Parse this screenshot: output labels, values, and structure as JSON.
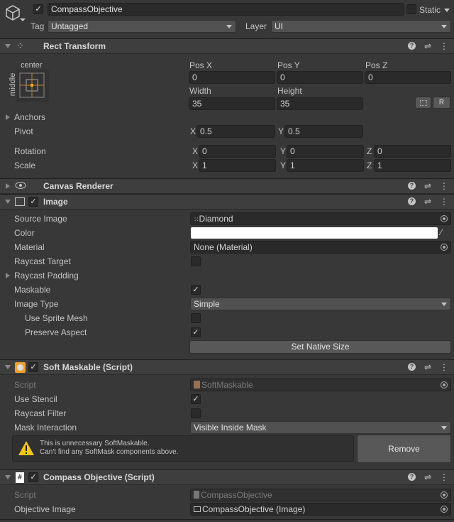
{
  "object": {
    "name": "CompassObjective",
    "active": true,
    "static_label": "Static",
    "static": false,
    "tag_label": "Tag",
    "tag": "Untagged",
    "layer_label": "Layer",
    "layer": "UI"
  },
  "rect_transform": {
    "title": "Rect Transform",
    "anchor_h": "center",
    "anchor_v": "middle",
    "pos_x_label": "Pos X",
    "pos_y_label": "Pos Y",
    "pos_z_label": "Pos Z",
    "pos_x": "0",
    "pos_y": "0",
    "pos_z": "0",
    "width_label": "Width",
    "height_label": "Height",
    "width": "35",
    "height": "35",
    "raw_button": "R",
    "anchors_label": "Anchors",
    "pivot_label": "Pivot",
    "pivot_x": "0.5",
    "pivot_y": "0.5",
    "rotation_label": "Rotation",
    "rot_x": "0",
    "rot_y": "0",
    "rot_z": "0",
    "scale_label": "Scale",
    "scale_x": "1",
    "scale_y": "1",
    "scale_z": "1",
    "x": "X",
    "y": "Y",
    "z": "Z"
  },
  "canvas_renderer": {
    "title": "Canvas Renderer"
  },
  "image": {
    "title": "Image",
    "enabled": true,
    "source_image_label": "Source Image",
    "source_image": "Diamond",
    "color_label": "Color",
    "color": "#ffffff",
    "material_label": "Material",
    "material": "None (Material)",
    "raycast_target_label": "Raycast Target",
    "raycast_target": false,
    "raycast_padding_label": "Raycast Padding",
    "maskable_label": "Maskable",
    "maskable": true,
    "image_type_label": "Image Type",
    "image_type": "Simple",
    "use_sprite_mesh_label": "Use Sprite Mesh",
    "use_sprite_mesh": false,
    "preserve_aspect_label": "Preserve Aspect",
    "preserve_aspect": true,
    "set_native_size": "Set Native Size"
  },
  "soft_maskable": {
    "title": "Soft Maskable (Script)",
    "enabled": true,
    "script_label": "Script",
    "script": "SoftMaskable",
    "use_stencil_label": "Use Stencil",
    "use_stencil": true,
    "raycast_filter_label": "Raycast Filter",
    "raycast_filter": false,
    "mask_interaction_label": "Mask Interaction",
    "mask_interaction": "Visible Inside Mask",
    "warning_line1": "This is unnecessary SoftMaskable.",
    "warning_line2": "Can't find any SoftMask components above.",
    "remove": "Remove"
  },
  "compass_objective": {
    "title": "Compass Objective (Script)",
    "enabled": true,
    "script_label": "Script",
    "script": "CompassObjective",
    "objective_image_label": "Objective Image",
    "objective_image": "CompassObjective (Image)"
  },
  "check": "✓"
}
